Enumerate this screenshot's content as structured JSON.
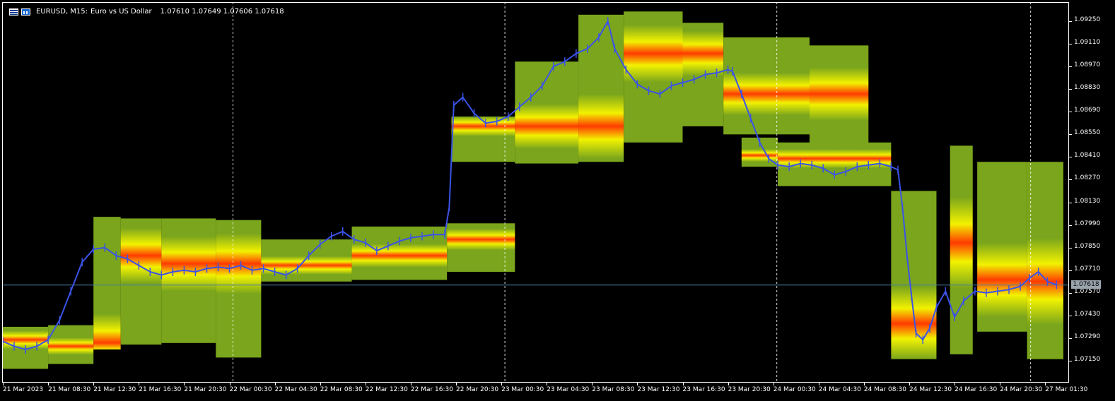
{
  "header": {
    "symbol": "EURUSD, M15:",
    "description": "Euro vs US Dollar",
    "ohlc": "1.07610 1.07649 1.07606 1.07618",
    "icons": [
      "list-icon",
      "bar-chart-icon"
    ]
  },
  "colors": {
    "background": "#000000",
    "price_line": "#3b53e8",
    "grid": "#ffffff",
    "heat_low": "#7aa51c",
    "heat_mid": "#f2f200",
    "heat_high": "#ff3b00",
    "current_price_line": "#4a7fa0"
  },
  "chart_data": {
    "type": "line",
    "title": "",
    "price_labels": [
      "1.09250",
      "1.09110",
      "1.08970",
      "1.08830",
      "1.08690",
      "1.08550",
      "1.08410",
      "1.08270",
      "1.08130",
      "1.07990",
      "1.07850",
      "1.07710",
      "1.07570",
      "1.07430",
      "1.07290",
      "1.07150"
    ],
    "time_labels": [
      "21 Mar 2023",
      "21 Mar 08:30",
      "21 Mar 12:30",
      "21 Mar 16:30",
      "21 Mar 20:30",
      "22 Mar 00:30",
      "22 Mar 04:30",
      "22 Mar 08:30",
      "22 Mar 12:30",
      "22 Mar 16:30",
      "22 Mar 20:30",
      "23 Mar 00:30",
      "23 Mar 04:30",
      "23 Mar 08:30",
      "23 Mar 12:30",
      "23 Mar 16:30",
      "23 Mar 20:30",
      "24 Mar 00:30",
      "24 Mar 04:30",
      "24 Mar 08:30",
      "24 Mar 12:30",
      "24 Mar 16:30",
      "24 Mar 20:30",
      "27 Mar 01:30"
    ],
    "ylim": [
      1.0709,
      1.0934
    ],
    "current_price": "1.07618",
    "day_separators": [
      5,
      11,
      17,
      22.6
    ],
    "series": [
      {
        "values": [
          1.0727,
          1.0724,
          1.0722,
          1.0724,
          1.0728,
          1.074,
          1.0758,
          1.0776,
          1.0784,
          1.0785,
          1.078,
          1.0778,
          1.0774,
          1.077,
          1.0768,
          1.077,
          1.0771,
          1.077,
          1.0772,
          1.0773,
          1.0772,
          1.0774,
          1.0771,
          1.0772,
          1.077,
          1.0768,
          1.0772,
          1.078,
          1.0787,
          1.0792,
          1.0795,
          1.079,
          1.0788,
          1.0783,
          1.0786,
          1.0789,
          1.0791,
          1.0792,
          1.0793,
          1.0793,
          1.081,
          1.0873,
          1.0878,
          1.0868,
          1.0862,
          1.0863,
          1.0866,
          1.0872,
          1.0878,
          1.0885,
          1.0897,
          1.09,
          1.0905,
          1.0908,
          1.0915,
          1.0925,
          1.0908,
          1.0895,
          1.0886,
          1.0882,
          1.088,
          1.0885,
          1.0887,
          1.0889,
          1.0892,
          1.0893,
          1.0895,
          1.0894,
          1.088,
          1.0865,
          1.085,
          1.084,
          1.0836,
          1.0835,
          1.0837,
          1.0836,
          1.0834,
          1.083,
          1.0832,
          1.0835,
          1.0836,
          1.0837,
          1.0835,
          1.0833,
          1.081,
          1.078,
          1.0755,
          1.0732,
          1.0728,
          1.0735,
          1.0748,
          1.0758,
          1.0742,
          1.0752,
          1.0758,
          1.0757,
          1.0758,
          1.0759,
          1.0761,
          1.0766,
          1.077,
          1.0764,
          1.0762
        ],
        "x_positions": [
          0,
          0.25,
          0.5,
          0.75,
          1,
          1.25,
          1.5,
          1.75,
          2,
          2.25,
          2.5,
          2.75,
          3,
          3.25,
          3.5,
          3.75,
          4,
          4.25,
          4.5,
          4.75,
          5,
          5.25,
          5.5,
          5.75,
          6,
          6.25,
          6.5,
          6.75,
          7,
          7.25,
          7.5,
          7.75,
          8,
          8.25,
          8.5,
          8.75,
          9,
          9.25,
          9.5,
          9.75,
          9.85,
          9.95,
          10.15,
          10.4,
          10.65,
          10.9,
          11.15,
          11.4,
          11.65,
          11.9,
          12.15,
          12.4,
          12.65,
          12.9,
          13.15,
          13.35,
          13.5,
          13.75,
          14,
          14.25,
          14.5,
          14.75,
          15,
          15.25,
          15.5,
          15.75,
          16,
          16.1,
          16.3,
          16.5,
          16.7,
          16.9,
          17.1,
          17.35,
          17.6,
          17.85,
          18.1,
          18.35,
          18.6,
          18.85,
          19.1,
          19.35,
          19.6,
          19.75,
          19.85,
          19.95,
          20.05,
          20.15,
          20.3,
          20.45,
          20.6,
          20.8,
          21,
          21.2,
          21.45,
          21.7,
          21.95,
          22.2,
          22.45,
          22.65,
          22.85,
          23.05,
          23.25
        ]
      }
    ],
    "heat_columns": [
      {
        "x0": 0,
        "x1": 1,
        "lo": 1.071,
        "hi": 1.0736,
        "peak": 1.0728
      },
      {
        "x0": 1,
        "x1": 2,
        "lo": 1.0713,
        "hi": 1.0737,
        "peak": 1.0724
      },
      {
        "x0": 2,
        "x1": 2.6,
        "lo": 1.0722,
        "hi": 1.0804,
        "peak": 1.0724
      },
      {
        "x0": 2.6,
        "x1": 3.5,
        "lo": 1.0725,
        "hi": 1.0803,
        "peak": 1.078
      },
      {
        "x0": 3.5,
        "x1": 4.7,
        "lo": 1.0726,
        "hi": 1.0803,
        "peak": 1.0775
      },
      {
        "x0": 4.7,
        "x1": 5.7,
        "lo": 1.0717,
        "hi": 1.0802,
        "peak": 1.0775
      },
      {
        "x0": 5.7,
        "x1": 7.7,
        "lo": 1.0764,
        "hi": 1.079,
        "peak": 1.0774
      },
      {
        "x0": 7.7,
        "x1": 9.8,
        "lo": 1.0765,
        "hi": 1.0798,
        "peak": 1.078
      },
      {
        "x0": 9.8,
        "x1": 11.3,
        "lo": 1.077,
        "hi": 1.08,
        "peak": 1.079
      },
      {
        "x0": 9.9,
        "x1": 11.3,
        "lo": 1.0838,
        "hi": 1.0866,
        "peak": 1.086
      },
      {
        "x0": 11.3,
        "x1": 12.7,
        "lo": 1.0837,
        "hi": 1.09,
        "peak": 1.086
      },
      {
        "x0": 12.7,
        "x1": 13.7,
        "lo": 1.0838,
        "hi": 1.0929,
        "peak": 1.086
      },
      {
        "x0": 13.7,
        "x1": 15,
        "lo": 1.085,
        "hi": 1.0931,
        "peak": 1.0905
      },
      {
        "x0": 15,
        "x1": 15.9,
        "lo": 1.086,
        "hi": 1.0924,
        "peak": 1.0905
      },
      {
        "x0": 15.9,
        "x1": 17.8,
        "lo": 1.0855,
        "hi": 1.0915,
        "peak": 1.088
      },
      {
        "x0": 17.8,
        "x1": 19.1,
        "lo": 1.0835,
        "hi": 1.091,
        "peak": 1.088
      },
      {
        "x0": 16.3,
        "x1": 17.1,
        "lo": 1.0835,
        "hi": 1.0853,
        "peak": 1.0842
      },
      {
        "x0": 17.1,
        "x1": 19.6,
        "lo": 1.0823,
        "hi": 1.085,
        "peak": 1.084
      },
      {
        "x0": 19.6,
        "x1": 20.6,
        "lo": 1.0716,
        "hi": 1.082,
        "peak": 1.0738
      },
      {
        "x0": 20.9,
        "x1": 21.4,
        "lo": 1.0719,
        "hi": 1.0848,
        "peak": 1.0788
      },
      {
        "x0": 21.5,
        "x1": 22.6,
        "lo": 1.0733,
        "hi": 1.0838,
        "peak": 1.0765
      },
      {
        "x0": 22.6,
        "x1": 23.4,
        "lo": 1.0716,
        "hi": 1.0838,
        "peak": 1.0764
      }
    ]
  }
}
